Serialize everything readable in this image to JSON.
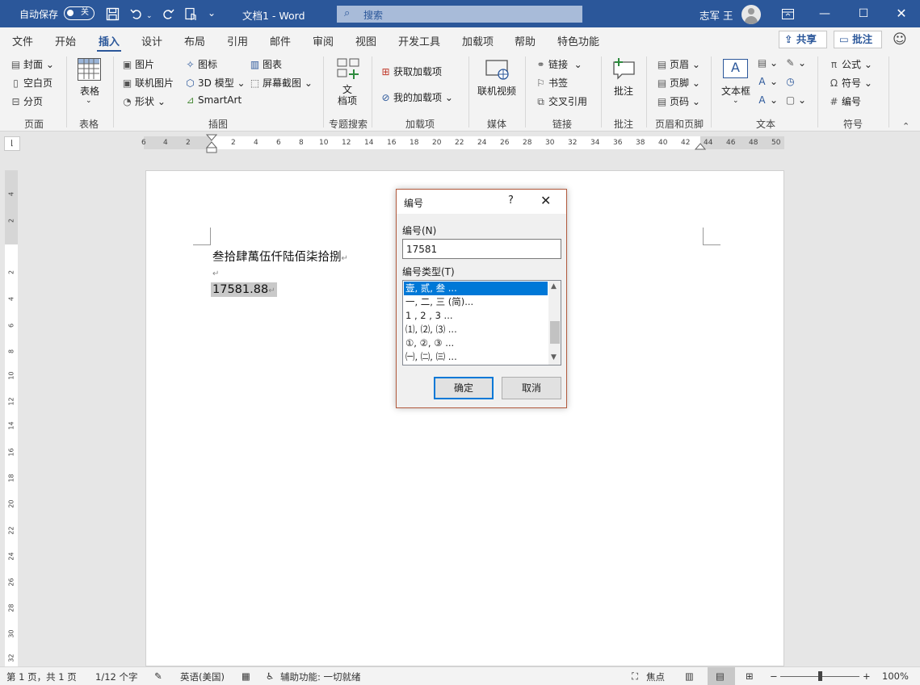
{
  "titlebar": {
    "autosave_label": "自动保存",
    "autosave_state": "关",
    "doc_title": "文档1  -  Word",
    "search_placeholder": "搜索",
    "user_name": "志军 王",
    "icons": [
      "save-icon",
      "undo-icon",
      "redo-icon",
      "touch-mode-icon",
      "customize-qat-icon"
    ]
  },
  "tabs": [
    "文件",
    "开始",
    "插入",
    "设计",
    "布局",
    "引用",
    "邮件",
    "审阅",
    "视图",
    "开发工具",
    "加载项",
    "帮助",
    "特色功能"
  ],
  "active_tab": "插入",
  "share_label": "共享",
  "comment_label": "批注",
  "ribbon": {
    "pages": {
      "cover": "封面",
      "blank": "空白页",
      "break": "分页",
      "group": "页面"
    },
    "tables": {
      "table": "表格",
      "group": "表格"
    },
    "illustrations": {
      "pictures": "图片",
      "online_pictures": "联机图片",
      "shapes": "形状",
      "icons": "图标",
      "models3d": "3D 模型",
      "smartart": "SmartArt",
      "chart": "图表",
      "screenshot": "屏幕截图",
      "group": "插图"
    },
    "search": {
      "doc_items": "文\n档项",
      "group": "专题搜索"
    },
    "addins": {
      "get": "获取加载项",
      "my": "我的加载项",
      "group": "加载项"
    },
    "media": {
      "video": "联机视频",
      "group": "媒体"
    },
    "links": {
      "link": "链接",
      "bookmark": "书签",
      "cross_ref": "交叉引用",
      "group": "链接"
    },
    "comments": {
      "comment": "批注",
      "group": "批注"
    },
    "header_footer": {
      "header": "页眉",
      "footer": "页脚",
      "page_number": "页码",
      "group": "页眉和页脚"
    },
    "text": {
      "textbox": "文本框",
      "group": "文本"
    },
    "symbols": {
      "equation": "公式",
      "symbol": "符号",
      "number": "编号",
      "group": "符号"
    }
  },
  "ruler": {
    "h_ticks": [
      "6",
      "4",
      "2",
      "2",
      "4",
      "6",
      "8",
      "10",
      "12",
      "14",
      "16",
      "18",
      "20",
      "22",
      "24",
      "26",
      "28",
      "30",
      "32",
      "34",
      "36",
      "38",
      "40",
      "42",
      "44",
      "46",
      "48",
      "50"
    ],
    "v_ticks": [
      "4",
      "2",
      "2",
      "4",
      "6",
      "8",
      "10",
      "12",
      "14",
      "16",
      "18",
      "20",
      "22",
      "24",
      "26",
      "28",
      "30",
      "32"
    ]
  },
  "document": {
    "line1": "叁拾肆萬伍仟陆佰柒拾捌",
    "line3": "17581.88"
  },
  "dialog": {
    "title": "编号",
    "help": "?",
    "number_label": "编号(N)",
    "number_value": "17581",
    "type_label": "编号类型(T)",
    "types": [
      "壹, 贰, 叁 ...",
      "一, 二, 三 (简)...",
      "1 , 2 , 3  ...",
      "⑴, ⑵, ⑶ ...",
      "①, ②, ③ ...",
      "㈠, ㈡, ㈢ ..."
    ],
    "selected_type_index": 0,
    "ok": "确定",
    "cancel": "取消"
  },
  "statusbar": {
    "page": "第 1 页，共 1 页",
    "words": "1/12 个字",
    "language": "英语(美国)",
    "accessibility": "辅助功能: 一切就绪",
    "focus": "焦点",
    "zoom": "100%"
  }
}
